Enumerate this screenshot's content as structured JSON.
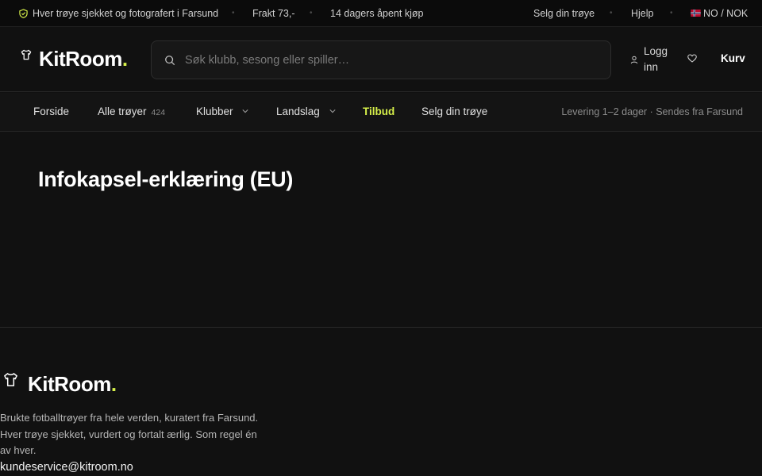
{
  "topbar": {
    "trust": "Hver trøye sjekket og fotografert i Farsund",
    "shipping": "Frakt 73,-",
    "returns": "14 dagers åpent kjøp",
    "sell": "Selg din trøye",
    "help": "Hjelp",
    "locale": "NO / NOK"
  },
  "header": {
    "logo_word": "KitRoom",
    "logo_dot": ".",
    "search_placeholder": "Søk klubb, sesong eller spiller…",
    "login": "Logg inn",
    "cart": "Kurv"
  },
  "nav": {
    "home": "Forside",
    "all": "Alle trøyer",
    "all_count": "424",
    "clubs": "Klubber",
    "national": "Landslag",
    "offers": "Tilbud",
    "sell": "Selg din trøye",
    "delivery": "Levering 1–2 dager · Sendes fra Farsund"
  },
  "main": {
    "title": "Infokapsel-erklæring (EU)"
  },
  "footer": {
    "logo_word": "KitRoom",
    "logo_dot": ".",
    "description": "Brukte fotballtrøyer fra hele verden, kuratert fra Farsund. Hver trøye sjekket, vurdert og fortalt ærlig. Som regel én av hver.",
    "email": "kundeservice@kitroom.no"
  },
  "colors": {
    "accent": "#d6f04a",
    "background": "#111111"
  },
  "icons": [
    "shield-check-icon",
    "norway-flag-icon",
    "shirt-icon",
    "search-icon",
    "user-icon",
    "heart-icon",
    "chevron-down-icon"
  ]
}
